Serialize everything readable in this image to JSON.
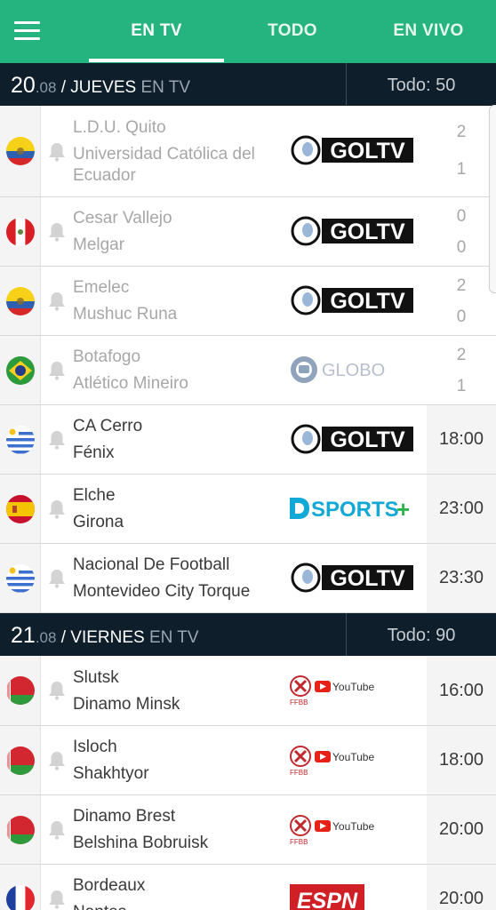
{
  "tabs": [
    {
      "label": "EN TV"
    },
    {
      "label": "TODO"
    },
    {
      "label": "EN VIVO"
    }
  ],
  "sections": [
    {
      "day": "20",
      "month": ".08",
      "weekday": " / JUEVES",
      "suffix": " EN TV",
      "total": "Todo: 50",
      "matches": [
        {
          "home": "L.D.U. Quito",
          "away": "Universidad Católica del Ecuador",
          "away_line2": "Ecuador",
          "channel": "GOLTV",
          "home_score": "2",
          "away_score": "1"
        },
        {
          "home": "Cesar Vallejo",
          "away": "Melgar",
          "channel": "GOLTV",
          "home_score": "0",
          "away_score": "0"
        },
        {
          "home": "Emelec",
          "away": "Mushuc Runa",
          "channel": "GOLTV",
          "home_score": "2",
          "away_score": "0"
        },
        {
          "home": "Botafogo",
          "away": "Atlético Mineiro",
          "channel": "GLOBO",
          "home_score": "2",
          "away_score": "1"
        },
        {
          "home": "CA Cerro",
          "away": "Fénix",
          "channel": "GOLTV",
          "time": "18:00"
        },
        {
          "home": "Elche",
          "away": "Girona",
          "channel": "DSPORTS+",
          "time": "23:00"
        },
        {
          "home": "Nacional De Football",
          "away": "Montevideo City Torque",
          "channel": "GOLTV",
          "time": "23:30"
        }
      ]
    },
    {
      "day": "21",
      "month": ".08",
      "weekday": " / VIERNES",
      "suffix": " EN TV",
      "total": "Todo: 90",
      "matches": [
        {
          "home": "Slutsk",
          "away": "Dinamo Minsk",
          "channel": "YouTube",
          "time": "16:00"
        },
        {
          "home": "Isloch",
          "away": "Shakhtyor",
          "channel": "YouTube",
          "time": "18:00"
        },
        {
          "home": "Dinamo Brest",
          "away": "Belshina Bobruisk",
          "channel": "YouTube",
          "time": "20:00"
        },
        {
          "home": "Bordeaux",
          "away": "Nantes",
          "channel": "ESPN",
          "time": "20:00"
        }
      ]
    }
  ],
  "flags": [
    "ecuador-flag",
    "peru-flag",
    "ecuador-flag",
    "brazil-flag",
    "uruguay-flag",
    "spain-flag",
    "uruguay-flag",
    "belarus-flag",
    "belarus-flag",
    "belarus-flag",
    "france-flag"
  ],
  "colors": {
    "topbar": "#25b37f",
    "header": "#0f1e2b",
    "goltv": "#111111",
    "dsports": "#13a9d6",
    "espn": "#d11f26"
  }
}
